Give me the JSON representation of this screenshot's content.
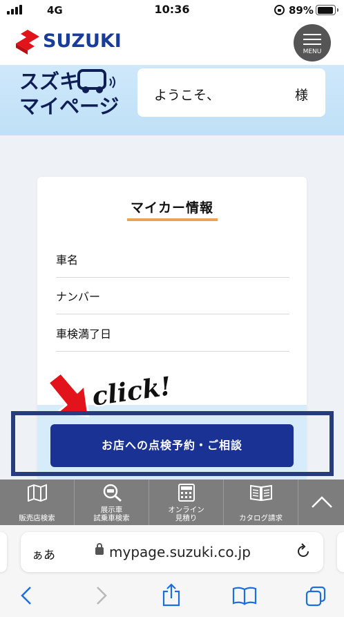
{
  "status_bar": {
    "network": "4G",
    "time": "10:36",
    "battery": "89%"
  },
  "header": {
    "brand": "SUZUKI",
    "menu_label": "MENU"
  },
  "banner": {
    "title_line1": "スズキ",
    "title_line2": "マイページ",
    "welcome_text": "ようこそ、",
    "honorific": "様"
  },
  "card": {
    "title": "マイカー情報",
    "fields": [
      "車名",
      "ナンバー",
      "車検満了日"
    ]
  },
  "annotation": {
    "click_text": "click!"
  },
  "reserve_button": {
    "label": "お店への点検予約・ご相談"
  },
  "site_nav": {
    "items": [
      {
        "line1": "販売店検索",
        "line2": "",
        "icon": "map-icon"
      },
      {
        "line1": "展示車",
        "line2": "試乗車検索",
        "icon": "car-search-icon"
      },
      {
        "line1": "オンライン",
        "line2": "見積り",
        "icon": "calculator-icon"
      },
      {
        "line1": "カタログ請求",
        "line2": "",
        "icon": "book-icon"
      }
    ]
  },
  "browser": {
    "aa_label": "ぁあ",
    "url": "mypage.suzuki.co.jp"
  },
  "colors": {
    "brand_blue": "#1a3294",
    "accent_orange": "#e9a257",
    "highlight_border": "#263c7c",
    "arrow_red": "#e3131b"
  }
}
